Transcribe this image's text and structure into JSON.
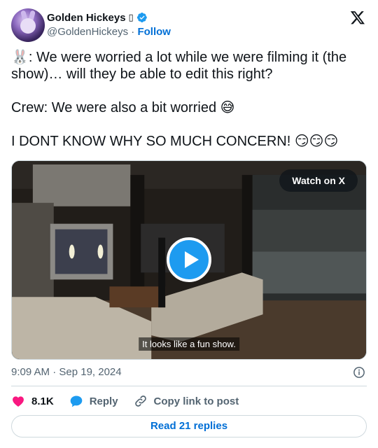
{
  "author": {
    "display_name": "Golden Hickeys",
    "name_emoji": "▯",
    "handle": "@GoldenHickeys",
    "separator": "·",
    "follow_label": "Follow"
  },
  "tweet": {
    "lines": [
      "🐰: We were worried a lot while we were filming it (the show)… will they be able to edit this right?",
      "Crew: We were also a bit worried 😅",
      "I DONT KNOW WHY SO MUCH CONCERN! 😏😏😏"
    ]
  },
  "media": {
    "watch_label": "Watch on X",
    "caption": "It looks like a fun show."
  },
  "meta": {
    "timestamp": "9:09 AM · Sep 19, 2024"
  },
  "actions": {
    "like_count": "8.1K",
    "reply_label": "Reply",
    "copy_label": "Copy link to post"
  },
  "footer": {
    "read_replies_label": "Read 21 replies"
  },
  "colors": {
    "link": "#006fd6",
    "like": "#f91880",
    "reply": "#1d9bf0",
    "verified": "#1d9bf0",
    "text": "#0f1419",
    "muted": "#536471"
  }
}
